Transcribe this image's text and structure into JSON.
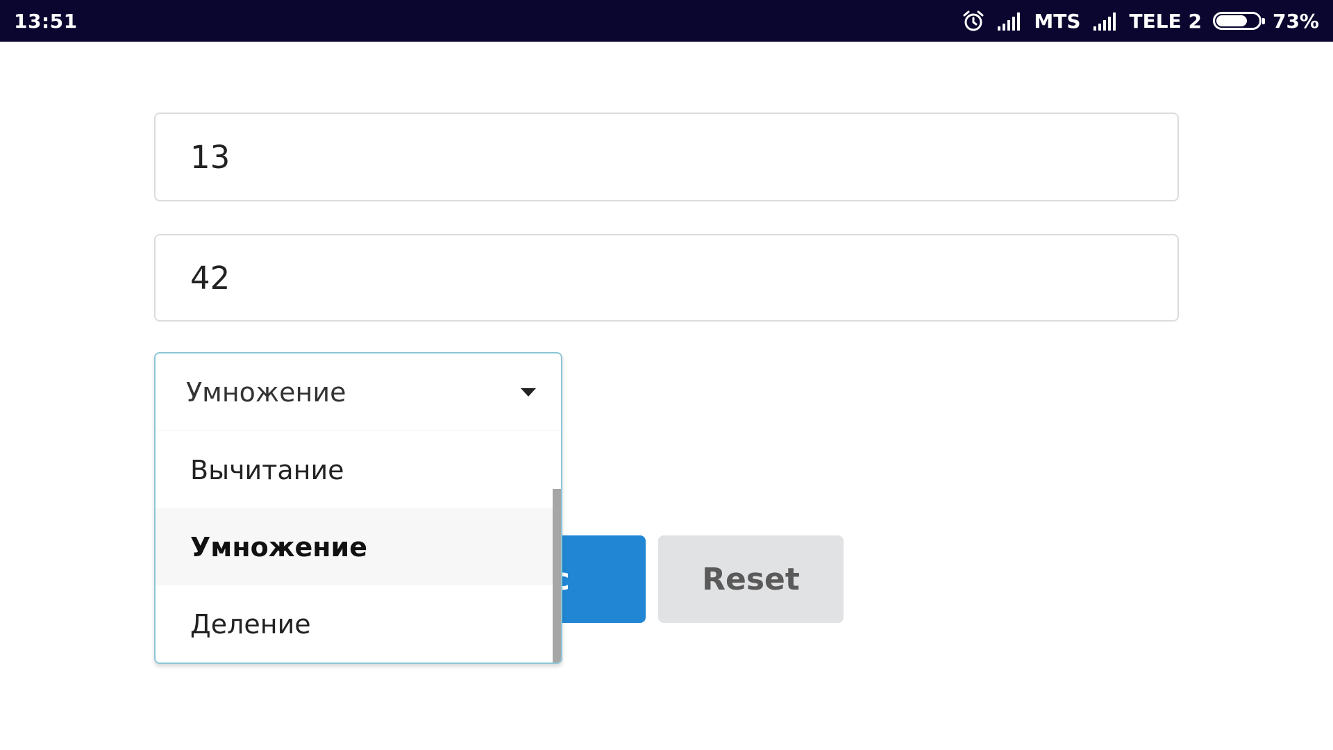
{
  "status_bar": {
    "time": "13:51",
    "carrier1": "MTS",
    "carrier2": "TELE 2",
    "battery": "73%",
    "battery_level": 0.73,
    "icons": [
      "alarm-icon",
      "signal-icon",
      "signal-icon",
      "battery-icon"
    ]
  },
  "form": {
    "input_a": "13",
    "input_b": "42",
    "operation": {
      "selected": "Умножение",
      "options": [
        "Вычитание",
        "Умножение",
        "Деление"
      ],
      "selected_index": 1
    },
    "calc_label": "alc",
    "reset_label": "Reset"
  },
  "colors": {
    "statusbar_bg": "#0b0630",
    "primary_button": "#2186d4",
    "secondary_button": "#e1e2e4",
    "dropdown_border": "#8cc6d6"
  }
}
